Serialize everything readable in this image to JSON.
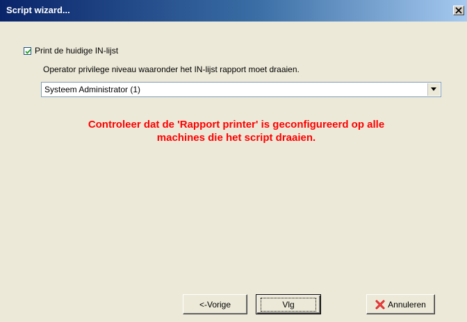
{
  "window": {
    "title": "Script wizard...",
    "close_glyph": "✕"
  },
  "form": {
    "print_checkbox": {
      "label": "Print de huidige IN-lijst",
      "checked": true
    },
    "operator_label": "Operator privilege niveau waaronder het IN-lijst rapport moet draaien.",
    "operator_select": {
      "value": "Systeem Administrator  (1)"
    },
    "warning_line1": "Controleer dat de 'Rapport printer' is geconfigureerd op alle",
    "warning_line2": "machines die het script draaien.",
    "warning_color": "#ff0000"
  },
  "buttons": {
    "prev_label": "<-Vorige",
    "next_label": "Vlg",
    "cancel_label": "Annuleren",
    "cancel_icon": "red-x-icon"
  }
}
